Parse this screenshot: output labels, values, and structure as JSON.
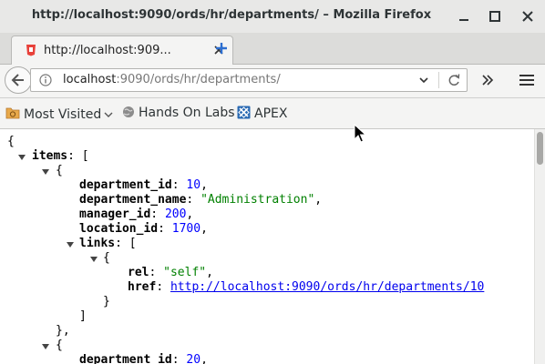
{
  "window": {
    "title": "http://localhost:9090/ords/hr/departments/ – Mozilla Firefox"
  },
  "tab": {
    "title": "http://localhost:9090/ords/hr/departments/",
    "title_shown": "http://localhost:909..."
  },
  "navbar": {
    "url_host": "localhost",
    "url_rest": ":9090/ords/hr/departments/"
  },
  "bookmarks": [
    {
      "label": "Most Visited",
      "icon": "most-visited-folder-icon"
    },
    {
      "label": "Hands On Labs",
      "icon": "globe-icon"
    },
    {
      "label": "APEX",
      "icon": "apex-icon"
    }
  ],
  "json_view": {
    "open_brace": "{",
    "items_key": "items",
    "item1": {
      "department_id_key": "department_id",
      "department_id": "10",
      "department_name_key": "department_name",
      "department_name": "\"Administration\"",
      "manager_id_key": "manager_id",
      "manager_id": "200",
      "location_id_key": "location_id",
      "location_id": "1700",
      "links_key": "links",
      "rel_key": "rel",
      "rel": "\"self\"",
      "href_key": "href",
      "href": "http://localhost:9090/ords/hr/departments/10"
    },
    "item2": {
      "department_id_key": "department_id",
      "department_id": "20"
    }
  },
  "colors": {
    "key": "#000000",
    "number": "#0000ff",
    "string": "#008000",
    "link": "#0000ee"
  }
}
